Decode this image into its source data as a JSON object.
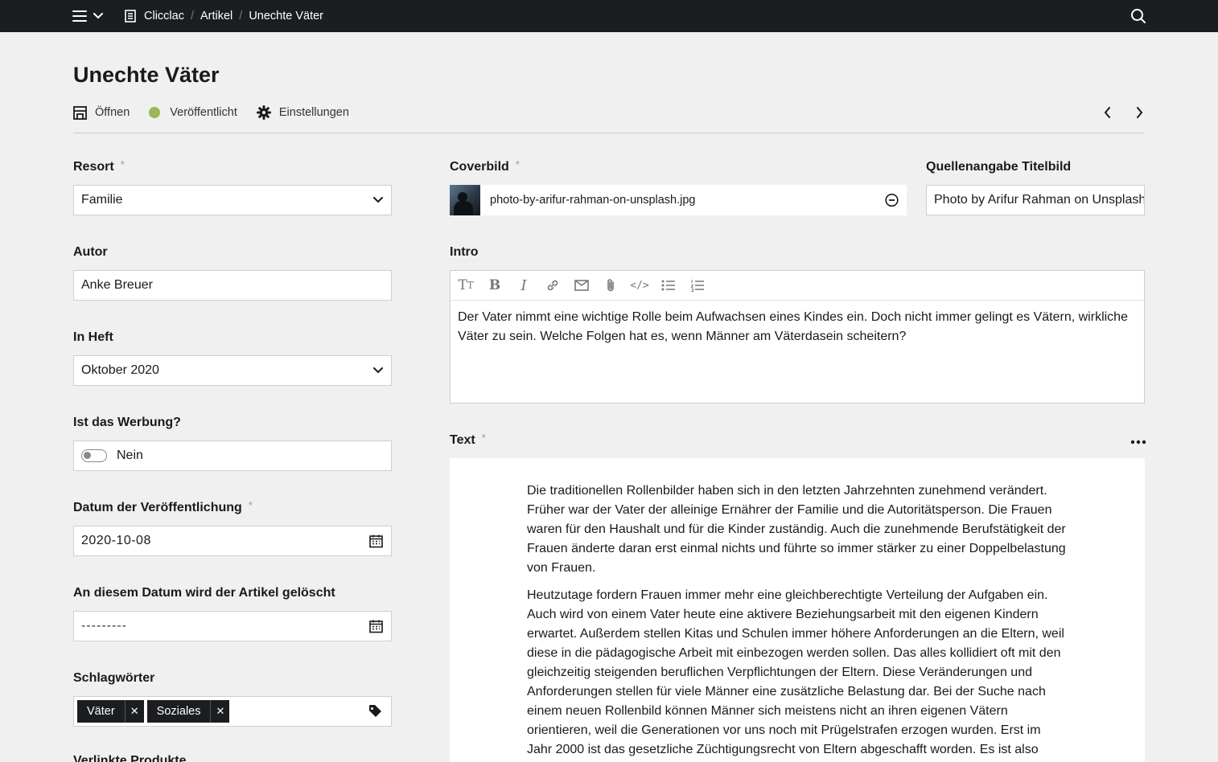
{
  "breadcrumb": [
    "Clicclac",
    "Artikel",
    "Unechte Väter"
  ],
  "title": "Unechte Väter",
  "actions": {
    "open": "Öffnen",
    "status": "Veröffentlicht",
    "settings": "Einstellungen"
  },
  "colors": {
    "status": "#9ab85a",
    "topbar": "#1b1d20"
  },
  "form": {
    "resort": {
      "label": "Resort",
      "value": "Familie"
    },
    "author": {
      "label": "Autor",
      "value": "Anke Breuer"
    },
    "issue": {
      "label": "In Heft",
      "value": "Oktober 2020"
    },
    "ad": {
      "label": "Ist das Werbung?",
      "value": "Nein"
    },
    "publish_date": {
      "label": "Datum der Veröffentlichung",
      "value": "2020-10-08"
    },
    "delete_date": {
      "label": "An diesem Datum wird der Artikel gelöscht",
      "value": "---------"
    },
    "tags": {
      "label": "Schlagwörter",
      "items": [
        "Väter",
        "Soziales"
      ]
    },
    "cut_label": "Verlinkte Produkte"
  },
  "cover": {
    "label": "Coverbild",
    "filename": "photo-by-arifur-rahman-on-unsplash.jpg"
  },
  "source": {
    "label": "Quellenangabe Titelbild",
    "value": "Photo by Arifur Rahman on Unsplash"
  },
  "intro": {
    "label": "Intro",
    "text": "Der Vater nimmt eine wichtige Rolle beim Aufwachsen eines Kindes ein. Doch nicht immer gelingt es Vätern, wirkliche Väter zu sein. Welche Folgen hat es, wenn Männer am Väterdasein scheitern?"
  },
  "text": {
    "label": "Text",
    "paragraphs": [
      "Die traditionellen Rollenbilder haben sich in den letzten Jahrzehnten zunehmend verändert. Früher war der Vater der alleinige Ernährer der Familie und die Autoritätsperson. Die Frauen waren für den Haushalt und für die Kinder zuständig. Auch die zunehmende Berufstätigkeit der Frauen änderte daran erst einmal nichts und führte so immer stärker zu einer Doppelbelastung von Frauen.",
      "Heutzutage fordern Frauen immer mehr eine gleichberechtigte Verteilung der Aufgaben ein. Auch wird von einem Vater heute eine aktivere Beziehungsarbeit mit den eigenen Kindern erwartet. Außerdem stellen Kitas und Schulen immer höhere Anforderungen an die Eltern, weil diese in die pädagogische Arbeit mit einbezogen werden sollen. Das alles kollidiert oft mit den gleichzeitig steigenden beruflichen Verpflichtungen der Eltern. Diese Veränderungen und Anforderungen stellen für viele Männer eine zusätzliche Belastung dar. Bei der Suche nach einem neuen Rollenbild können Männer sich meistens nicht an ihren eigenen Vätern orientieren, weil die Generationen vor uns noch mit Prügelstrafen erzogen wurden. Erst im Jahr 2000 ist das gesetzliche Züchtigungsrecht von Eltern abgeschafft worden. Es ist also"
    ]
  }
}
